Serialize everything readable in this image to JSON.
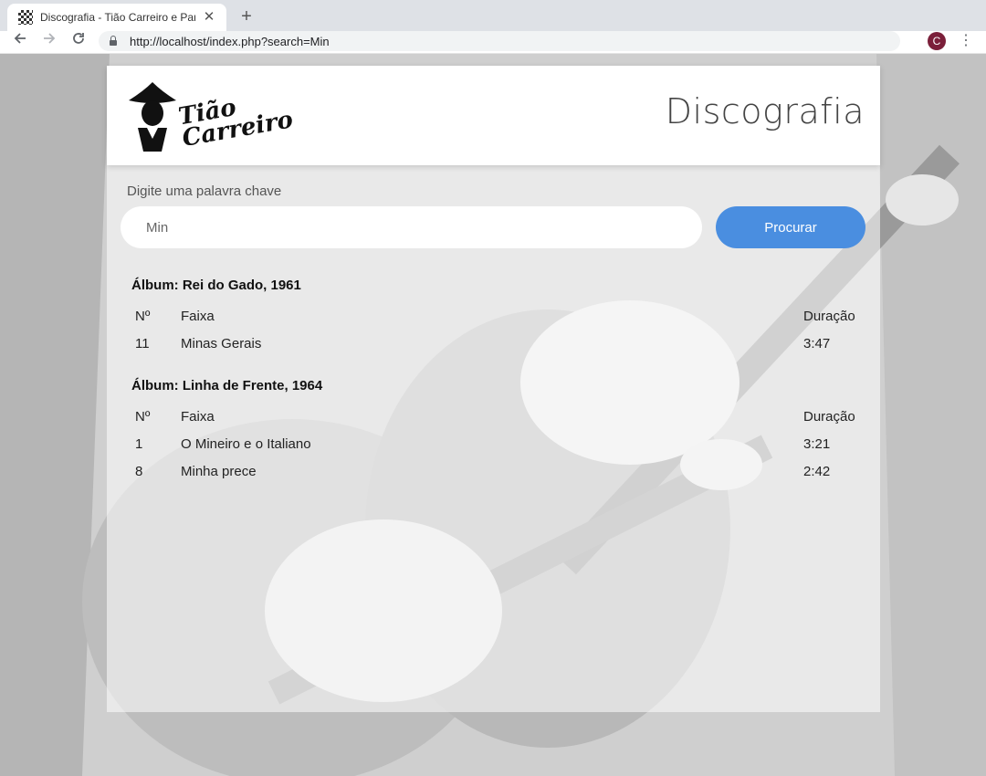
{
  "browser": {
    "tab_title": "Discografia - Tião Carreiro e Par",
    "url": "http://localhost/index.php?search=Min",
    "profile_initial": "C"
  },
  "header": {
    "logo_text": "Tião Carreiro",
    "title": "Discografia"
  },
  "search": {
    "label": "Digite uma palavra chave",
    "value": "Min",
    "button_label": "Procurar"
  },
  "columns": {
    "no": "Nº",
    "track": "Faixa",
    "duration": "Duração"
  },
  "albums": [
    {
      "title": "Álbum: Rei do Gado, 1961",
      "tracks": [
        {
          "no": "11",
          "name": "Minas Gerais",
          "duration": "3:47"
        }
      ]
    },
    {
      "title": "Álbum: Linha de Frente, 1964",
      "tracks": [
        {
          "no": "1",
          "name": "O Mineiro e o Italiano",
          "duration": "3:21"
        },
        {
          "no": "8",
          "name": "Minha prece",
          "duration": "2:42"
        }
      ]
    }
  ]
}
